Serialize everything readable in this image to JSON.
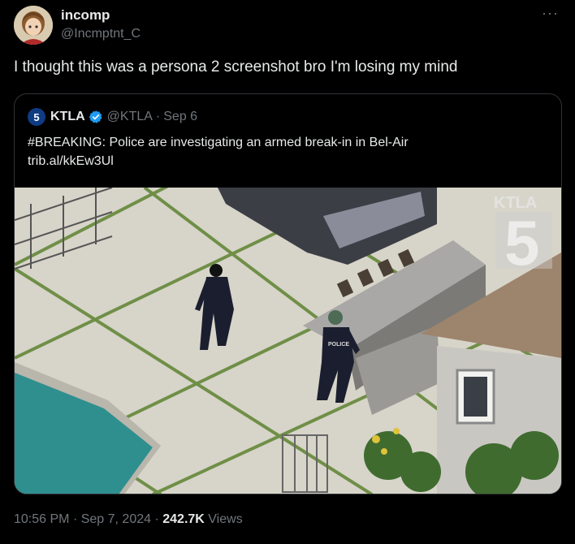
{
  "author": {
    "name": "incomp",
    "handle": "@Incmptnt_C",
    "avatar_icon": "anime-character-avatar"
  },
  "more_label": "···",
  "tweet_text": "I thought this was a persona 2 screenshot bro I'm losing my mind",
  "quote": {
    "logo_text": "5",
    "name": "KTLA",
    "handle": "@KTLA",
    "separator": "·",
    "date": "Sep 6",
    "text_line1": "#BREAKING: Police are investigating an armed break-in in Bel-Air",
    "text_line2": "trib.al/kkEw3Ul",
    "image": {
      "watermark_text": "KTLA",
      "watermark_number": "5",
      "officer_vest_text": "POLICE"
    }
  },
  "footer": {
    "time": "10:56 PM",
    "sep1": "·",
    "date": "Sep 7, 2024",
    "sep2": "·",
    "views_count": "242.7K",
    "views_label": "Views"
  },
  "colors": {
    "background": "#000000",
    "text": "#e7e9ea",
    "muted": "#71767b",
    "border": "#2f3336",
    "verified": "#1d9bf0"
  }
}
